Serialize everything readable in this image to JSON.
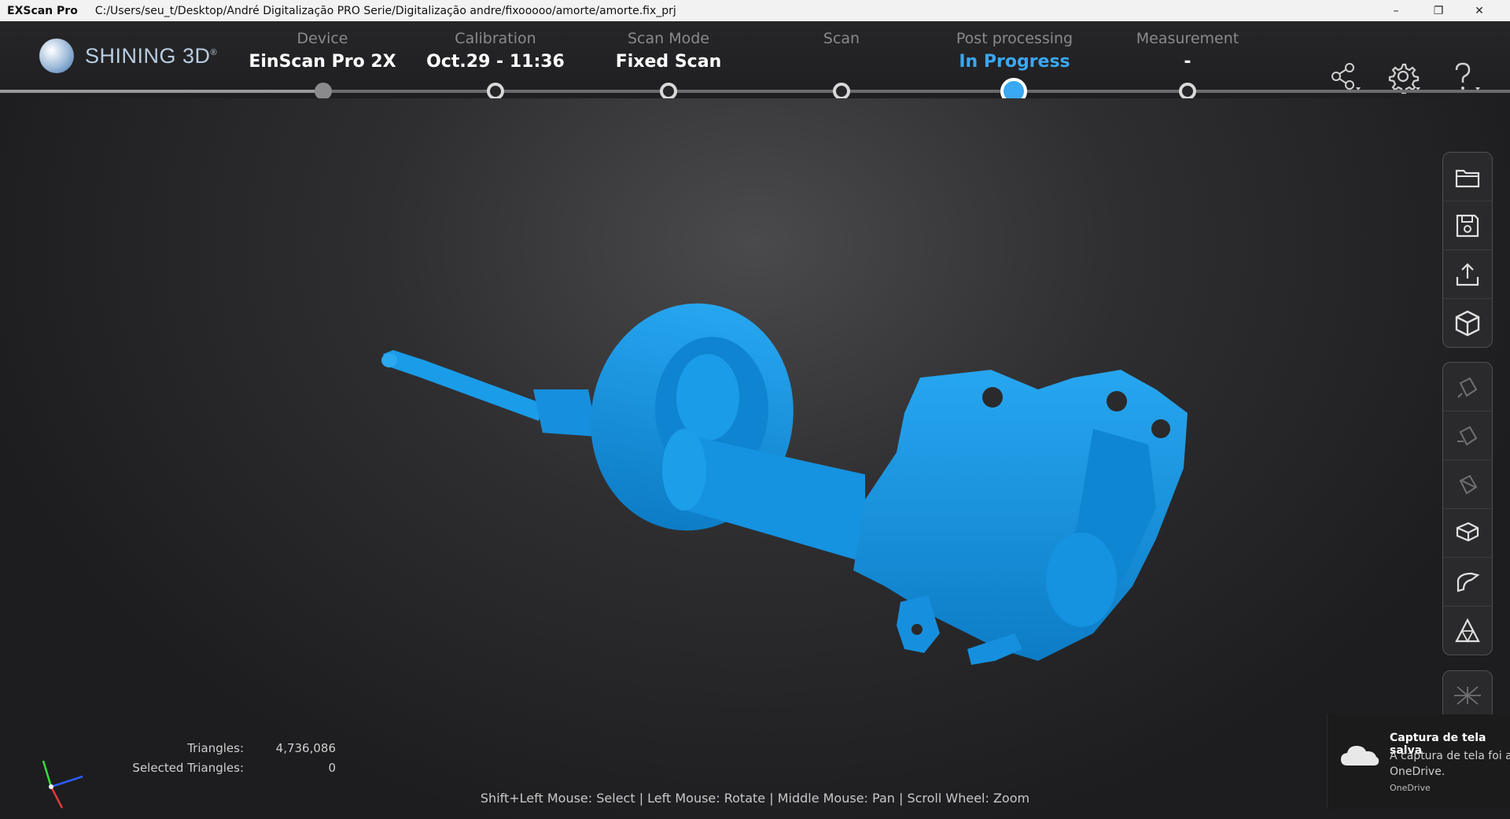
{
  "window": {
    "app_name": "EXScan Pro",
    "path": "C:/Users/seu_t/Desktop/André Digitalização PRO Serie/Digitalização andre/fixooooo/amorte/amorte.fix_prj",
    "minimize": "–",
    "restore": "❐",
    "close": "✕"
  },
  "logo": {
    "text": "SHINING 3D",
    "mark": "®"
  },
  "steps": [
    {
      "label": "Device",
      "value": "EinScan Pro 2X",
      "state": "done"
    },
    {
      "label": "Calibration",
      "value": "Oct.29 - 11:36",
      "state": "pending"
    },
    {
      "label": "Scan Mode",
      "value": "Fixed Scan",
      "state": "pending"
    },
    {
      "label": "Scan",
      "value": "",
      "state": "pending"
    },
    {
      "label": "Post processing",
      "value": "In Progress",
      "state": "active"
    },
    {
      "label": "Measurement",
      "value": "-",
      "state": "pending"
    }
  ],
  "header_icons": [
    "share-icon",
    "settings-icon",
    "help-icon"
  ],
  "file_tools": [
    "open-folder-icon",
    "save-icon",
    "export-icon",
    "model-cube-icon"
  ],
  "edit_tools": [
    "select-tool-icon",
    "deselect-tool-icon",
    "invert-selection-icon",
    "fill-holes-icon",
    "smooth-icon",
    "simplify-icon"
  ],
  "extra_tools": [
    "mesh-icon"
  ],
  "stats": {
    "triangles_label": "Triangles:",
    "triangles_value": "4,736,086",
    "selected_label": "Selected Triangles:",
    "selected_value": "0"
  },
  "hint": "Shift+Left Mouse: Select | Left Mouse: Rotate | Middle Mouse: Pan | Scroll Wheel: Zoom",
  "toast": {
    "title": "Captura de tela salva",
    "message_line1": "A captura de tela foi ad",
    "message_line2": "OneDrive.",
    "source": "OneDrive"
  },
  "colors": {
    "accent": "#3aa8f2",
    "model": "#1596e4",
    "background": "#1d1d1f"
  }
}
